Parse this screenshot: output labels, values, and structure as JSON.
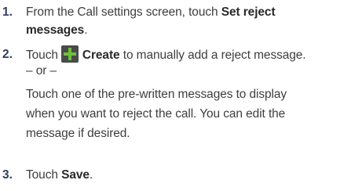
{
  "steps": [
    {
      "number": "1.",
      "lines": [
        {
          "pre": "From the Call settings screen, touch ",
          "bold": "Set reject"
        },
        {
          "bold": "messages",
          "post": "."
        }
      ]
    },
    {
      "number": "2.",
      "line1": {
        "pre": "Touch",
        "bold": "Create",
        "post": " to manually add a reject message."
      },
      "or": "– or –",
      "para": [
        "Touch one of the pre-written messages to display",
        "when you want to reject the call. You can edit the",
        "message if desired."
      ]
    },
    {
      "number": "3.",
      "line1": {
        "pre": "Touch ",
        "bold": "Save",
        "post": "."
      }
    }
  ],
  "icons": {
    "create": "plus-icon",
    "create_color": "#6fbf3a"
  }
}
